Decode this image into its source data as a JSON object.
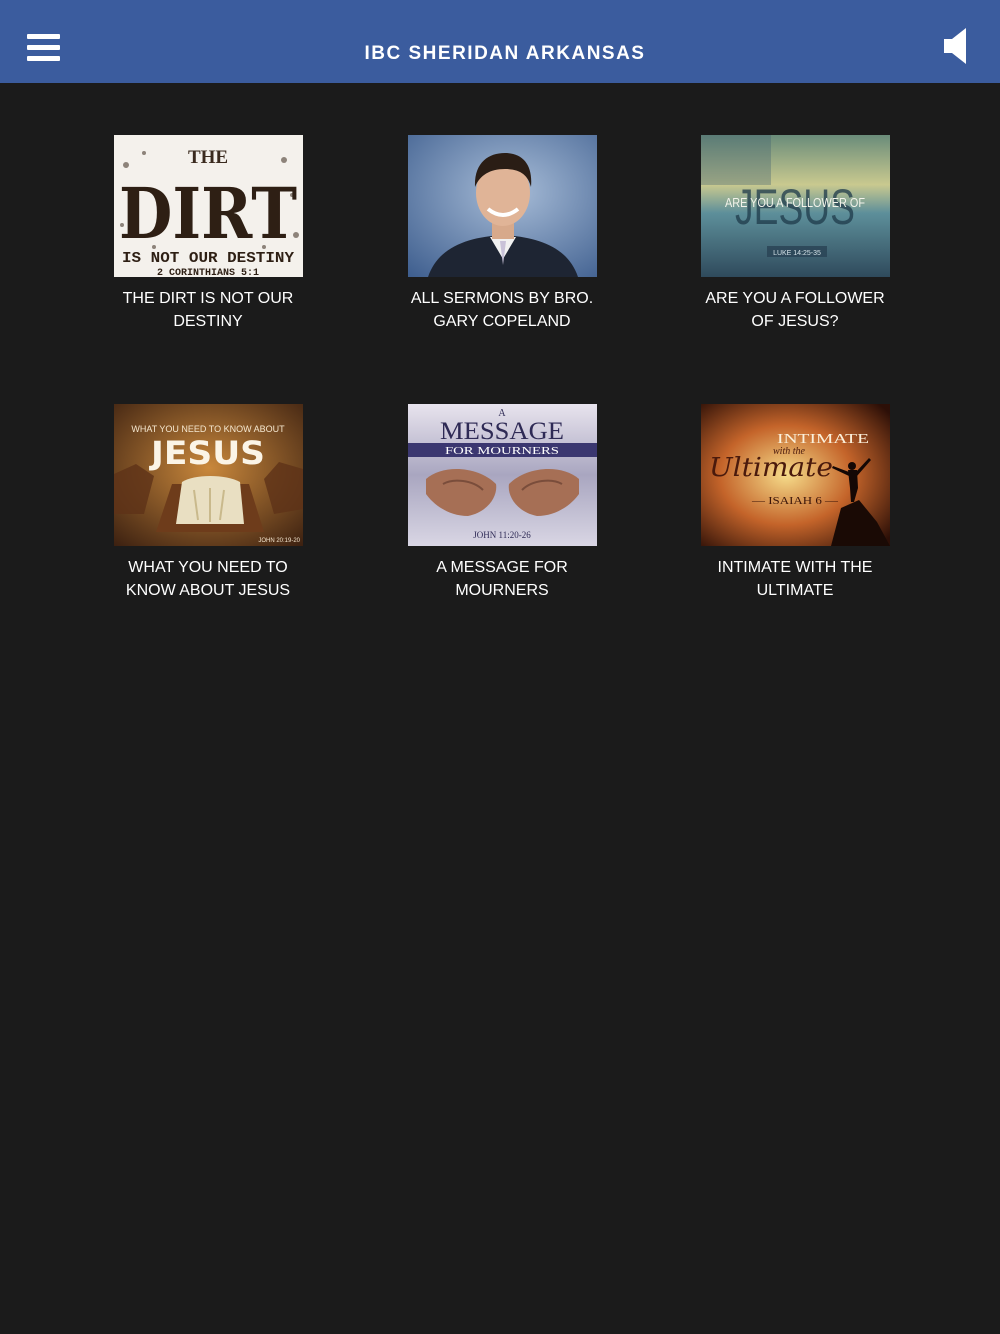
{
  "header": {
    "title": "IBC SHERIDAN ARKANSAS",
    "menu_icon": "hamburger-menu-icon",
    "audio_icon": "speaker-icon"
  },
  "colors": {
    "header_bg": "#3b5c9e",
    "page_bg": "#1b1b1b",
    "text": "#ffffff"
  },
  "sermons": [
    {
      "title": "THE DIRT IS NOT OUR\nDESTINY",
      "image": {
        "line1": "THE",
        "line2": "DIRT",
        "line3": "IS NOT OUR DESTINY",
        "line4": "2 CORINTHIANS 5:1"
      }
    },
    {
      "title": "ALL SERMONS BY BRO.\nGARY COPELAND",
      "image": {}
    },
    {
      "title": "ARE YOU A FOLLOWER\nOF JESUS?",
      "image": {
        "line1": "ARE YOU A FOLLOWER OF",
        "line2": "JESUS",
        "line3": "LUKE 14:25-35"
      }
    },
    {
      "title": "WHAT YOU NEED TO\nKNOW ABOUT JESUS",
      "image": {
        "line1": "WHAT YOU NEED TO KNOW ABOUT",
        "line2": "JESUS",
        "line3": "JOHN 20:19-20"
      }
    },
    {
      "title": "A MESSAGE FOR\nMOURNERS",
      "image": {
        "line1": "A",
        "line2": "MESSAGE",
        "line3": "FOR MOURNERS",
        "line4": "JOHN 11:20-26"
      }
    },
    {
      "title": "INTIMATE WITH THE\nULTIMATE",
      "image": {
        "line1": "INTIMATE",
        "line2": "with the",
        "line3": "Ultimate",
        "line4": "— ISAIAH 6 —"
      }
    }
  ]
}
